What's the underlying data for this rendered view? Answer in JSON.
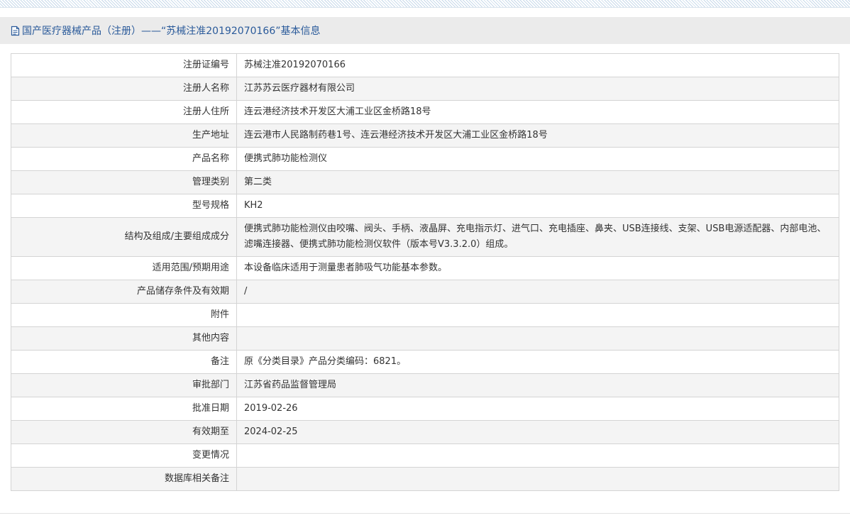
{
  "header": {
    "title": "国产医疗器械产品（注册）——“苏械注准20192070166”基本信息"
  },
  "rows": [
    {
      "label": "注册证编号",
      "value": "苏械注准20192070166"
    },
    {
      "label": "注册人名称",
      "value": "江苏苏云医疗器材有限公司"
    },
    {
      "label": "注册人住所",
      "value": "连云港经济技术开发区大浦工业区金桥路18号"
    },
    {
      "label": "生产地址",
      "value": "连云港市人民路制药巷1号、连云港经济技术开发区大浦工业区金桥路18号"
    },
    {
      "label": "产品名称",
      "value": "便携式肺功能检测仪"
    },
    {
      "label": "管理类别",
      "value": "第二类"
    },
    {
      "label": "型号规格",
      "value": "KH2"
    },
    {
      "label": "结构及组成/主要组成成分",
      "value": "便携式肺功能检测仪由咬嘴、阀头、手柄、液晶屏、充电指示灯、进气口、充电插座、鼻夹、USB连接线、支架、USB电源适配器、内部电池、滤嘴连接器、便携式肺功能检测仪软件（版本号V3.3.2.0）组成。"
    },
    {
      "label": "适用范围/预期用途",
      "value": "本设备临床适用于测量患者肺吸气功能基本参数。"
    },
    {
      "label": "产品储存条件及有效期",
      "value": "/"
    },
    {
      "label": "附件",
      "value": ""
    },
    {
      "label": "其他内容",
      "value": ""
    },
    {
      "label": "备注",
      "value": "原《分类目录》产品分类编码：6821。"
    },
    {
      "label": "审批部门",
      "value": "江苏省药品监督管理局"
    },
    {
      "label": "批准日期",
      "value": "2019-02-26"
    },
    {
      "label": "有效期至",
      "value": "2024-02-25"
    },
    {
      "label": "变更情况",
      "value": ""
    },
    {
      "label": "数据库相关备注",
      "value": ""
    }
  ],
  "colors": {
    "title_text": "#2a5a9a",
    "title_bar_bg": "#ebebeb",
    "border": "#d4d4d4",
    "alt_row_bg": "#f4f4f4"
  },
  "icons": {
    "title_icon": "document-icon"
  }
}
